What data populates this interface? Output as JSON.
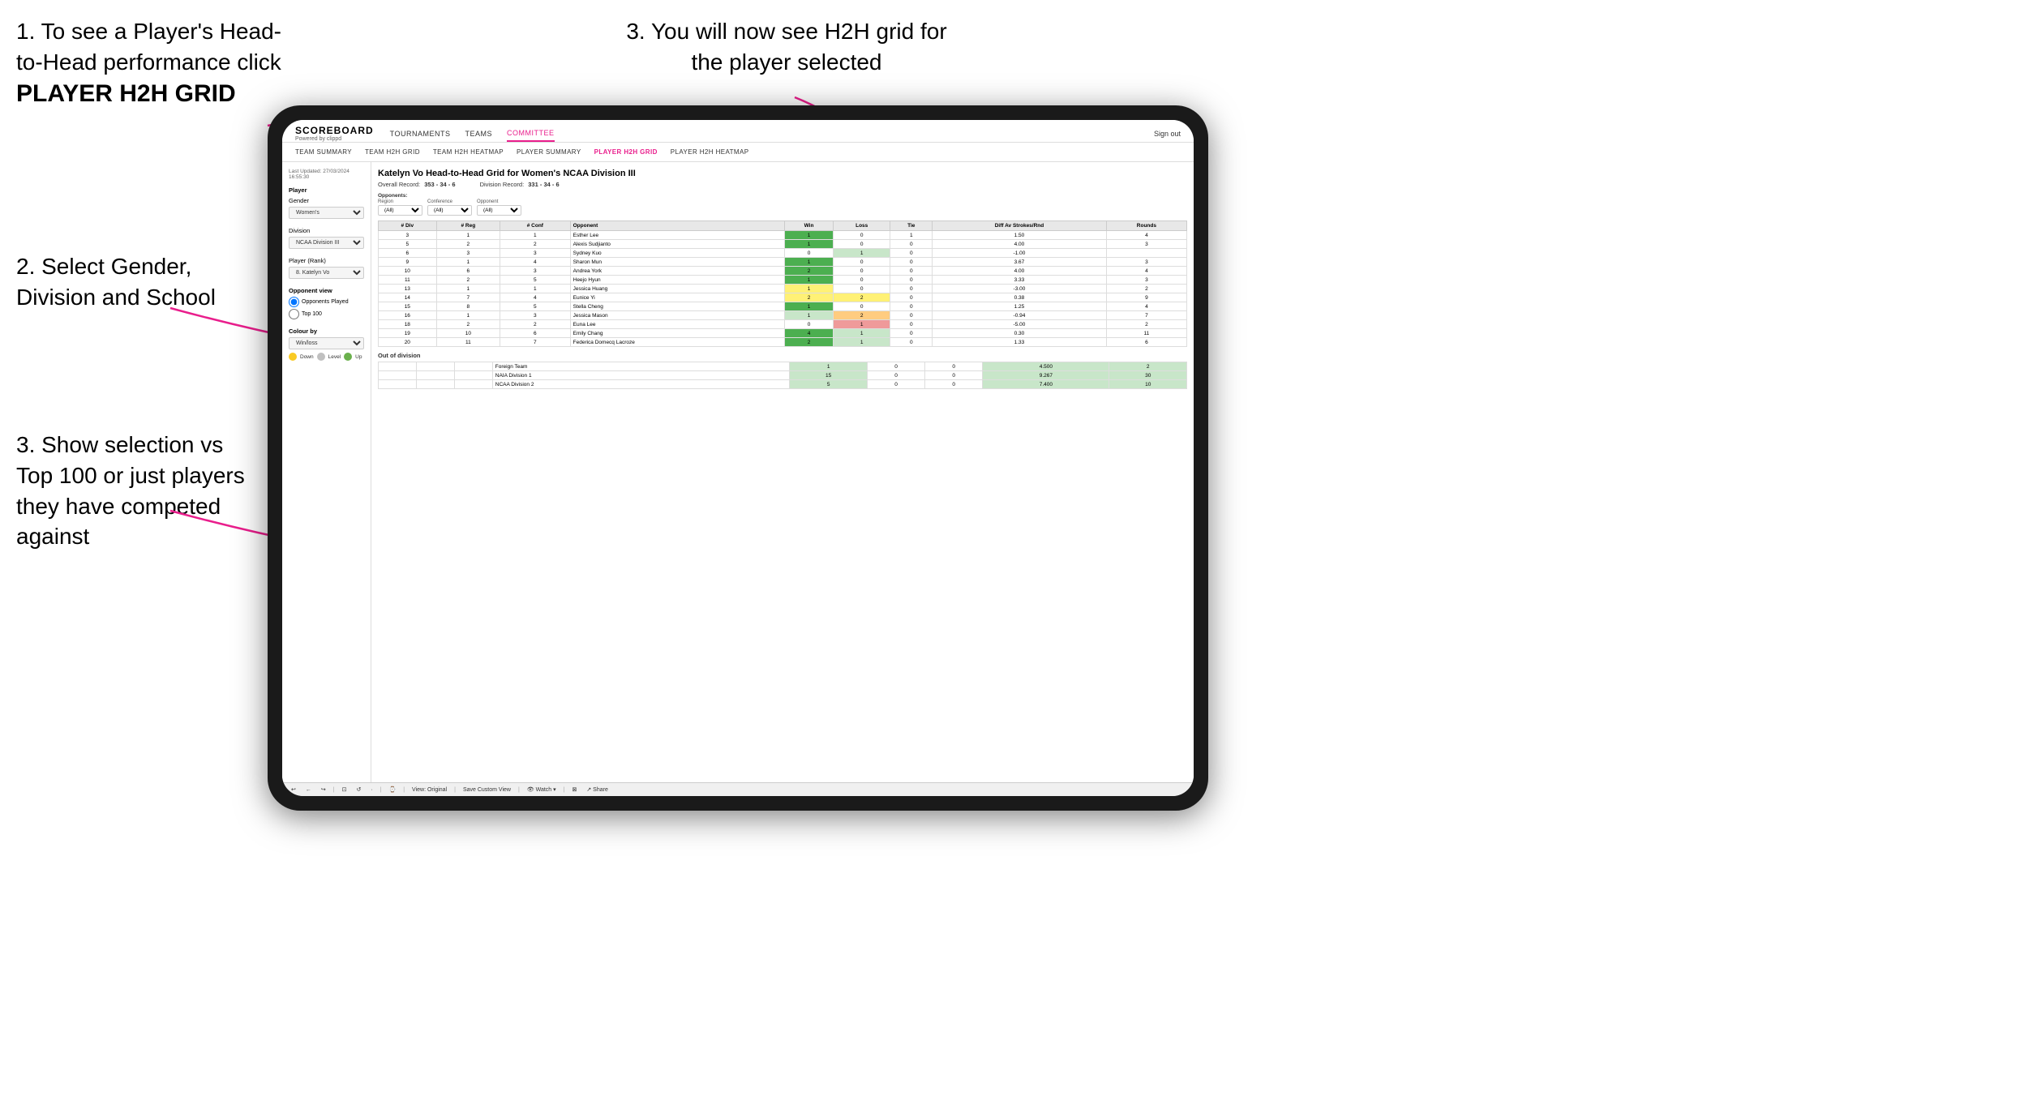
{
  "instructions": {
    "top_left_1": "1. To see a Player's Head-to-Head performance click",
    "top_left_2": "PLAYER H2H GRID",
    "top_right": "3. You will now see H2H grid for the player selected",
    "mid_left": "2. Select Gender, Division and School",
    "bot_left": "3. Show selection vs Top 100 or just players they have competed against"
  },
  "nav": {
    "logo": "SCOREBOARD",
    "logo_sub": "Powered by clippd",
    "links": [
      "TOURNAMENTS",
      "TEAMS",
      "COMMITTEE",
      ""
    ],
    "sign_out": "Sign out",
    "sign_in_icon": "i"
  },
  "sub_nav": {
    "links": [
      "TEAM SUMMARY",
      "TEAM H2H GRID",
      "TEAM H2H HEATMAP",
      "PLAYER SUMMARY",
      "PLAYER H2H GRID",
      "PLAYER H2H HEATMAP"
    ]
  },
  "sidebar": {
    "timestamp_label": "Last Updated: 27/03/2024",
    "timestamp_time": "16:55:30",
    "player_label": "Player",
    "gender_label": "Gender",
    "gender_value": "Women's",
    "division_label": "Division",
    "division_value": "NCAA Division III",
    "player_rank_label": "Player (Rank)",
    "player_rank_value": "8. Katelyn Vo",
    "opponent_view_label": "Opponent view",
    "radio_1": "Opponents Played",
    "radio_2": "Top 100",
    "colour_by_label": "Colour by",
    "colour_by_value": "Win/loss",
    "legend": [
      {
        "color": "#f9ca24",
        "label": "Down"
      },
      {
        "color": "#c0c0c0",
        "label": "Level"
      },
      {
        "color": "#6ab04c",
        "label": "Up"
      }
    ]
  },
  "grid": {
    "title": "Katelyn Vo Head-to-Head Grid for Women's NCAA Division III",
    "overall_record_label": "Overall Record:",
    "overall_record": "353 - 34 - 6",
    "division_record_label": "Division Record:",
    "division_record": "331 - 34 - 6",
    "filter_opponents_label": "Opponents:",
    "filter_region_label": "Region",
    "filter_conference_label": "Conference",
    "filter_opponent_label": "Opponent",
    "filter_all": "(All)",
    "columns": [
      "# Div",
      "# Reg",
      "# Conf",
      "Opponent",
      "Win",
      "Loss",
      "Tie",
      "Diff Av Strokes/Rnd",
      "Rounds"
    ],
    "rows": [
      {
        "div": "3",
        "reg": "1",
        "conf": "1",
        "opponent": "Esther Lee",
        "win": "1",
        "loss": "0",
        "tie": "1",
        "diff": "1.50",
        "rounds": "4",
        "win_color": "green-dark",
        "loss_color": "white",
        "tie_color": "white"
      },
      {
        "div": "5",
        "reg": "2",
        "conf": "2",
        "opponent": "Alexis Sudjianto",
        "win": "1",
        "loss": "0",
        "tie": "0",
        "diff": "4.00",
        "rounds": "3",
        "win_color": "green-dark",
        "loss_color": "white",
        "tie_color": "white"
      },
      {
        "div": "6",
        "reg": "3",
        "conf": "3",
        "opponent": "Sydney Kuo",
        "win": "0",
        "loss": "1",
        "tie": "0",
        "diff": "-1.00",
        "rounds": "",
        "win_color": "white",
        "loss_color": "green-light",
        "tie_color": "white"
      },
      {
        "div": "9",
        "reg": "1",
        "conf": "4",
        "opponent": "Sharon Mun",
        "win": "1",
        "loss": "0",
        "tie": "0",
        "diff": "3.67",
        "rounds": "3",
        "win_color": "green-dark",
        "loss_color": "white",
        "tie_color": "white"
      },
      {
        "div": "10",
        "reg": "6",
        "conf": "3",
        "opponent": "Andrea York",
        "win": "2",
        "loss": "0",
        "tie": "0",
        "diff": "4.00",
        "rounds": "4",
        "win_color": "green-dark",
        "loss_color": "white",
        "tie_color": "white"
      },
      {
        "div": "11",
        "reg": "2",
        "conf": "5",
        "opponent": "Heejo Hyun",
        "win": "1",
        "loss": "0",
        "tie": "0",
        "diff": "3.33",
        "rounds": "3",
        "win_color": "green-dark",
        "loss_color": "white",
        "tie_color": "white"
      },
      {
        "div": "13",
        "reg": "1",
        "conf": "1",
        "opponent": "Jessica Huang",
        "win": "1",
        "loss": "0",
        "tie": "0",
        "diff": "-3.00",
        "rounds": "2",
        "win_color": "yellow",
        "loss_color": "white",
        "tie_color": "white"
      },
      {
        "div": "14",
        "reg": "7",
        "conf": "4",
        "opponent": "Eunice Yi",
        "win": "2",
        "loss": "2",
        "tie": "0",
        "diff": "0.38",
        "rounds": "9",
        "win_color": "yellow",
        "loss_color": "yellow",
        "tie_color": "white"
      },
      {
        "div": "15",
        "reg": "8",
        "conf": "5",
        "opponent": "Stella Cheng",
        "win": "1",
        "loss": "0",
        "tie": "0",
        "diff": "1.25",
        "rounds": "4",
        "win_color": "green-dark",
        "loss_color": "white",
        "tie_color": "white"
      },
      {
        "div": "16",
        "reg": "1",
        "conf": "3",
        "opponent": "Jessica Mason",
        "win": "1",
        "loss": "2",
        "tie": "0",
        "diff": "-0.94",
        "rounds": "7",
        "win_color": "green-light",
        "loss_color": "orange",
        "tie_color": "white"
      },
      {
        "div": "18",
        "reg": "2",
        "conf": "2",
        "opponent": "Euna Lee",
        "win": "0",
        "loss": "1",
        "tie": "0",
        "diff": "-5.00",
        "rounds": "2",
        "win_color": "white",
        "loss_color": "red",
        "tie_color": "white"
      },
      {
        "div": "19",
        "reg": "10",
        "conf": "6",
        "opponent": "Emily Chang",
        "win": "4",
        "loss": "1",
        "tie": "0",
        "diff": "0.30",
        "rounds": "11",
        "win_color": "green-dark",
        "loss_color": "green-light",
        "tie_color": "white"
      },
      {
        "div": "20",
        "reg": "11",
        "conf": "7",
        "opponent": "Federica Domecq Lacroze",
        "win": "2",
        "loss": "1",
        "tie": "0",
        "diff": "1.33",
        "rounds": "6",
        "win_color": "green-dark",
        "loss_color": "green-light",
        "tie_color": "white"
      }
    ],
    "out_of_division_label": "Out of division",
    "out_of_division_rows": [
      {
        "label": "Foreign Team",
        "win": "1",
        "loss": "0",
        "tie": "0",
        "diff": "4.500",
        "rounds": "2"
      },
      {
        "label": "NAIA Division 1",
        "win": "15",
        "loss": "0",
        "tie": "0",
        "diff": "9.267",
        "rounds": "30"
      },
      {
        "label": "NCAA Division 2",
        "win": "5",
        "loss": "0",
        "tie": "0",
        "diff": "7.400",
        "rounds": "10"
      }
    ]
  },
  "toolbar": {
    "buttons": [
      "↩",
      "←",
      "↪",
      "⊡",
      "↺",
      "·",
      "⌚",
      "View: Original",
      "Save Custom View",
      "👁 Watch ▾",
      "⊠",
      "↗ Share"
    ]
  }
}
